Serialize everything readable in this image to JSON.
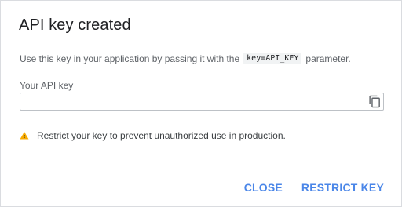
{
  "dialog": {
    "title": "API key created",
    "description_before": "Use this key in your application by passing it with the",
    "description_code": "key=API_KEY",
    "description_after": "parameter.",
    "field_label": "Your API key",
    "api_key_value": "",
    "warning_text": "Restrict your key to prevent unauthorized use in production.",
    "buttons": {
      "close": "CLOSE",
      "restrict": "RESTRICT KEY"
    }
  },
  "icons": {
    "copy": "copy-icon",
    "warning": "warning-icon"
  },
  "colors": {
    "accent": "#4a86e8",
    "warning": "#f9ab00",
    "text_primary": "#202124",
    "text_secondary": "#5f6368"
  }
}
